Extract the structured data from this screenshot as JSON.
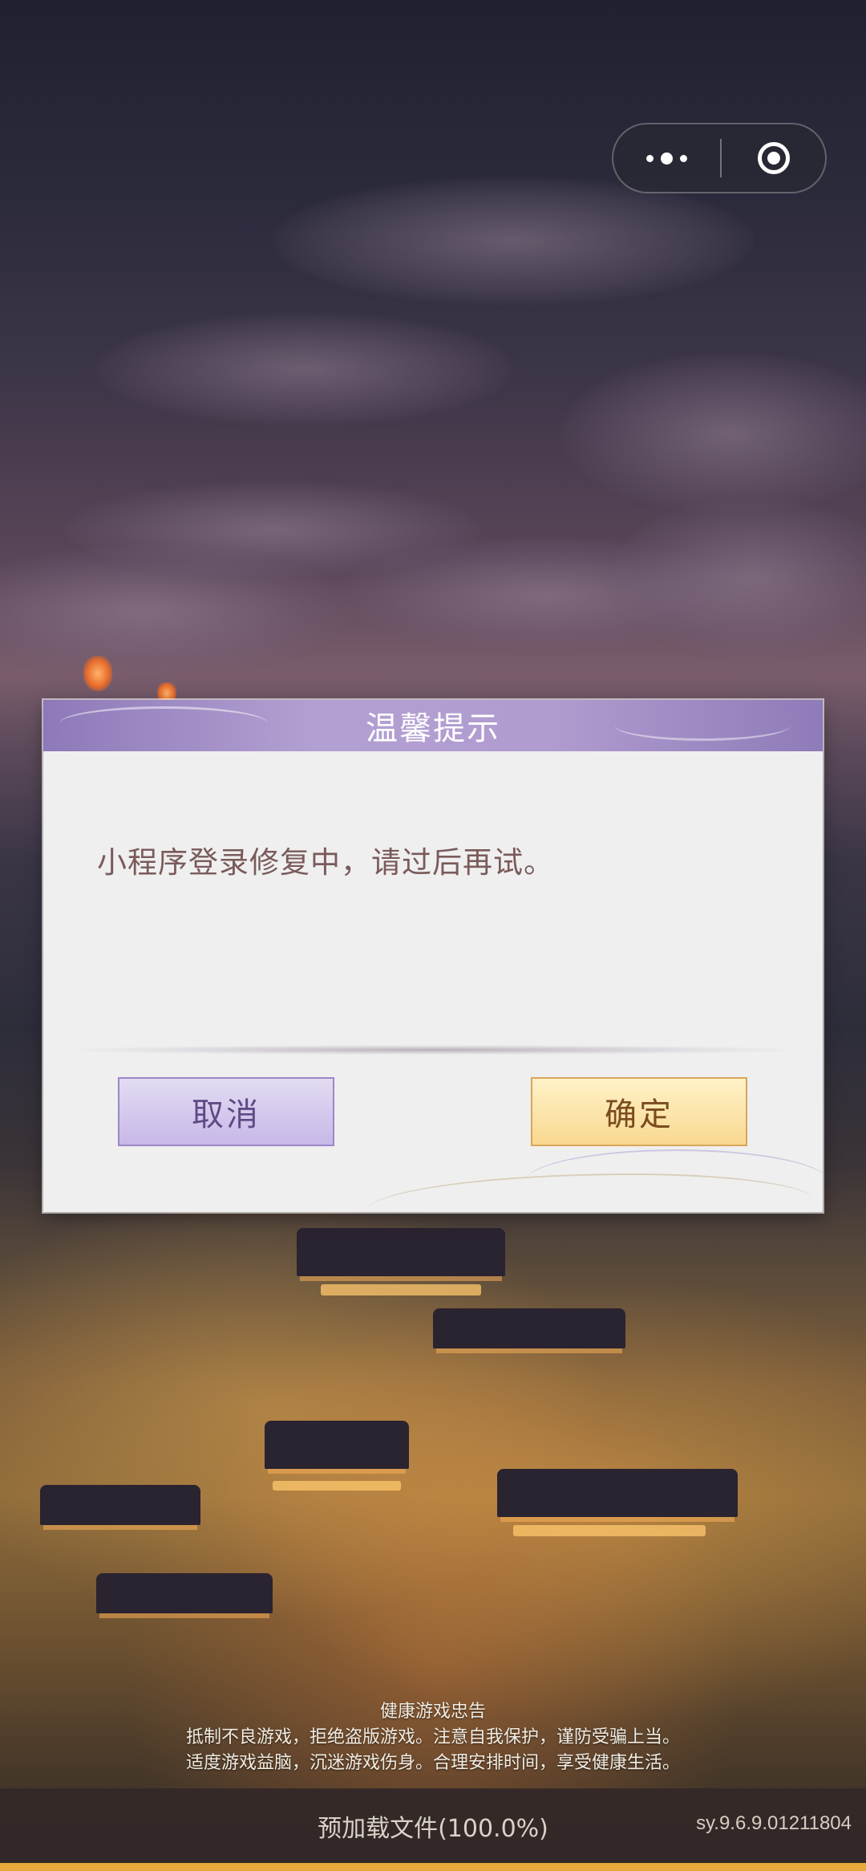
{
  "capsule": {
    "more_icon": "more-dots-icon",
    "close_icon": "target-close-icon"
  },
  "dialog": {
    "title": "温馨提示",
    "message": "小程序登录修复中，请过后再试。",
    "cancel_label": "取消",
    "confirm_label": "确定"
  },
  "notice": {
    "title": "健康游戏忠告",
    "line1": "抵制不良游戏，拒绝盗版游戏。注意自我保护，谨防受骗上当。",
    "line2": "适度游戏益脑，沉迷游戏伤身。合理安排时间，享受健康生活。"
  },
  "loading": {
    "text": "预加载文件(100.0%)",
    "progress": 1.0,
    "version": "sy.9.6.9.01211804"
  },
  "colors": {
    "dialog_header": "#b3a0d2",
    "cancel_button": "#c7b8e8",
    "confirm_button": "#f9d890",
    "message_text": "#7a5a5a",
    "progress_fill": "#e9a93a"
  }
}
